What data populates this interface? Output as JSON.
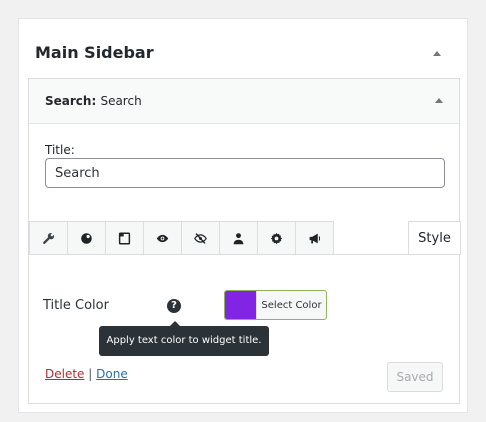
{
  "sidebar": {
    "title": "Main Sidebar"
  },
  "widget": {
    "name": "Search",
    "separator": ":",
    "instance_title": "Search",
    "title_label": "Title:",
    "title_value": "Search"
  },
  "tabs": {
    "icons": [
      "wrench-icon",
      "brush-icon",
      "window-icon",
      "eye-icon",
      "eye-hidden-icon",
      "user-icon",
      "gear-icon",
      "megaphone-icon"
    ],
    "active": "Style"
  },
  "style_panel": {
    "title_color_label": "Title Color",
    "help_glyph": "?",
    "tooltip": "Apply text color to widget title.",
    "color_picker_label": "Select Color",
    "selected_color": "#8224e3"
  },
  "actions": {
    "delete_label": "Delete",
    "separator": "|",
    "done_label": "Done",
    "saved_label": "Saved"
  },
  "colors": {
    "delete_link": "#b32d2e",
    "done_link": "#2271b1",
    "picker_border": "#8fb35a"
  }
}
